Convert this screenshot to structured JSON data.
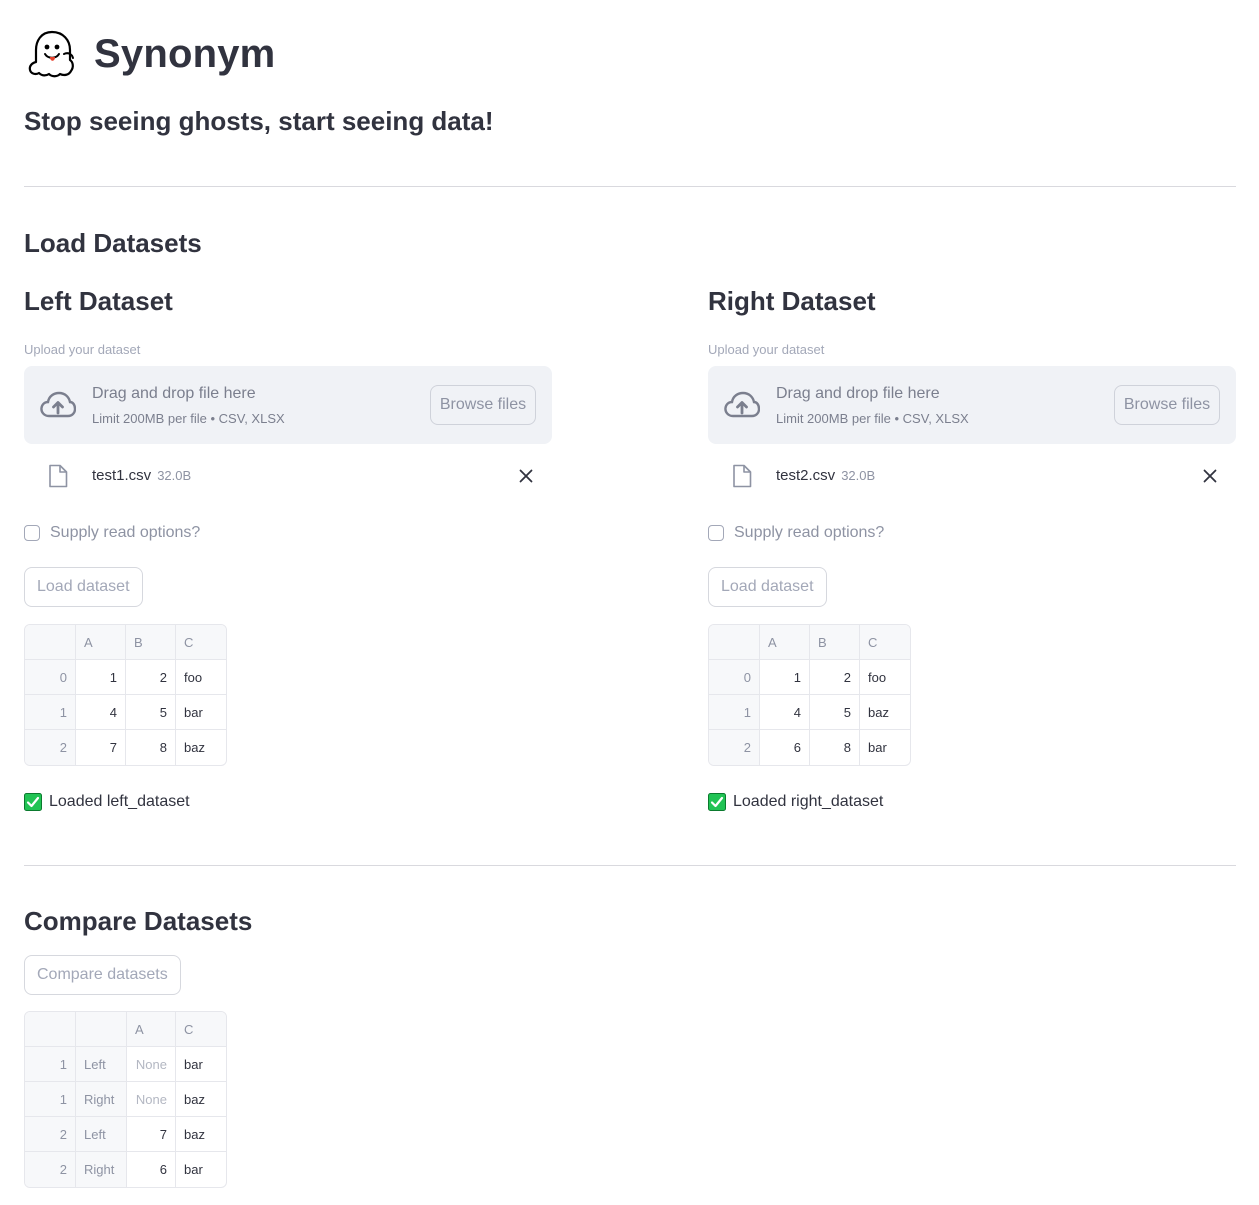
{
  "app": {
    "title": "Synonym",
    "tagline": "Stop seeing ghosts, start seeing data!"
  },
  "load_section": {
    "heading": "Load Datasets"
  },
  "left": {
    "title": "Left Dataset",
    "upload_label": "Upload your dataset",
    "dropzone_main": "Drag and drop file here",
    "dropzone_sub": "Limit 200MB per file • CSV, XLSX",
    "browse_label": "Browse files",
    "file_name": "test1.csv",
    "file_size": "32.0B",
    "checkbox_label": "Supply read options?",
    "load_label": "Load dataset",
    "table": {
      "columns": [
        "",
        "A",
        "B",
        "C"
      ],
      "rows": [
        {
          "idx": "0",
          "A": "1",
          "B": "2",
          "C": "foo"
        },
        {
          "idx": "1",
          "A": "4",
          "B": "5",
          "C": "bar"
        },
        {
          "idx": "2",
          "A": "7",
          "B": "8",
          "C": "baz"
        }
      ]
    },
    "status": "Loaded left_dataset"
  },
  "right": {
    "title": "Right Dataset",
    "upload_label": "Upload your dataset",
    "dropzone_main": "Drag and drop file here",
    "dropzone_sub": "Limit 200MB per file • CSV, XLSX",
    "browse_label": "Browse files",
    "file_name": "test2.csv",
    "file_size": "32.0B",
    "checkbox_label": "Supply read options?",
    "load_label": "Load dataset",
    "table": {
      "columns": [
        "",
        "A",
        "B",
        "C"
      ],
      "rows": [
        {
          "idx": "0",
          "A": "1",
          "B": "2",
          "C": "foo"
        },
        {
          "idx": "1",
          "A": "4",
          "B": "5",
          "C": "baz"
        },
        {
          "idx": "2",
          "A": "6",
          "B": "8",
          "C": "bar"
        }
      ]
    },
    "status": "Loaded right_dataset"
  },
  "compare_section": {
    "heading": "Compare Datasets",
    "button_label": "Compare datasets",
    "table": {
      "columns": [
        "",
        "",
        "A",
        "C"
      ],
      "rows": [
        {
          "idx": "1",
          "side": "Left",
          "A": "None",
          "C": "bar"
        },
        {
          "idx": "1",
          "side": "Right",
          "A": "None",
          "C": "baz"
        },
        {
          "idx": "2",
          "side": "Left",
          "A": "7",
          "C": "baz"
        },
        {
          "idx": "2",
          "side": "Right",
          "A": "6",
          "C": "bar"
        }
      ]
    }
  },
  "colors": {
    "text": "#31333f",
    "muted": "#8e93a3",
    "dropzone_bg": "#f0f2f6",
    "success": "#21c354"
  },
  "icons": [
    "ghost-logo-icon",
    "cloud-upload-icon",
    "file-icon",
    "close-icon",
    "check-box-icon"
  ]
}
